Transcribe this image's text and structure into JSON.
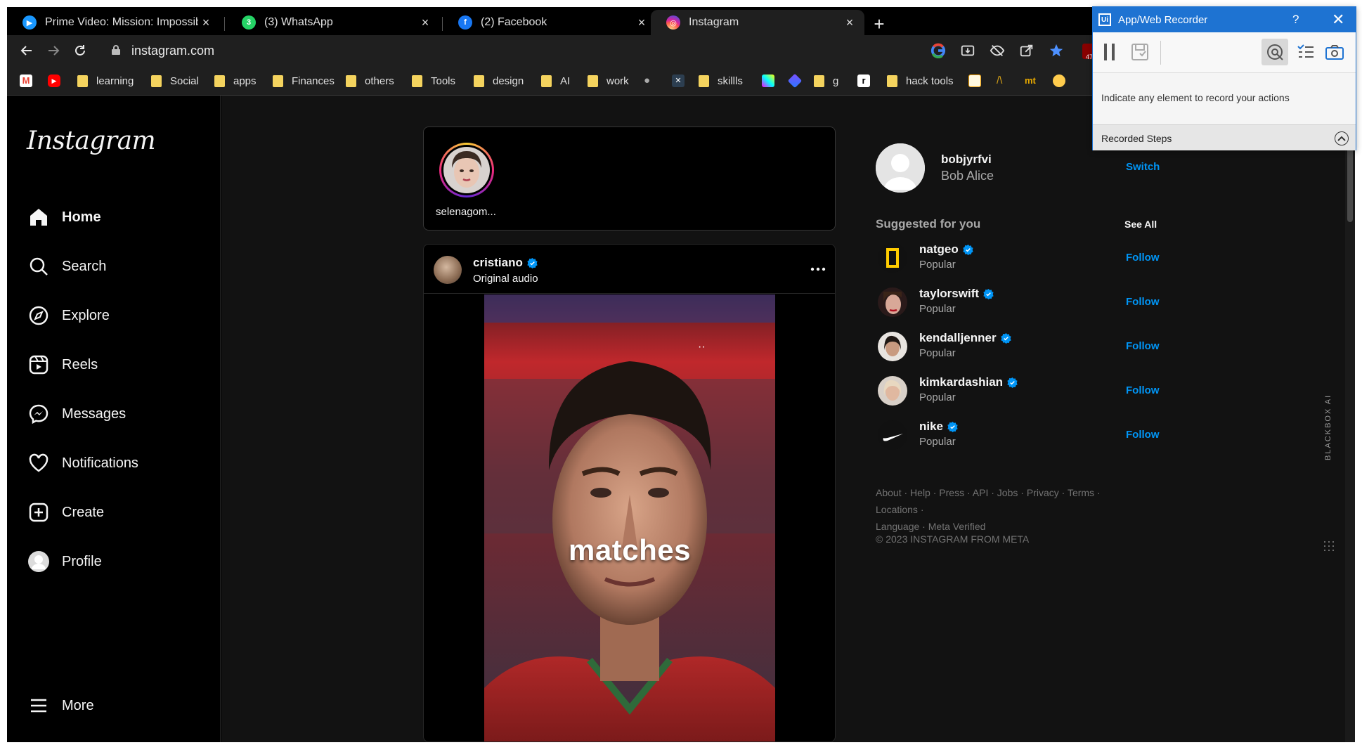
{
  "tabs": [
    {
      "title": "Prime Video: Mission: Impossible",
      "favicon": "prime-video-icon",
      "color": "#1a98ff"
    },
    {
      "title": "(3) WhatsApp",
      "favicon": "whatsapp-icon",
      "color": "#25d366",
      "badge": "3"
    },
    {
      "title": "(2) Facebook",
      "favicon": "facebook-icon",
      "color": "#1877f2"
    },
    {
      "title": "Instagram",
      "favicon": "instagram-icon",
      "color": "#e1306c"
    }
  ],
  "newtab_label": "+",
  "tab_close_glyph": "×",
  "address": {
    "url": "instagram.com"
  },
  "extension_badge": "47",
  "bookmarks": [
    {
      "label": "learning"
    },
    {
      "label": "Social"
    },
    {
      "label": "apps"
    },
    {
      "label": "Finances"
    },
    {
      "label": "others"
    },
    {
      "label": "Tools"
    },
    {
      "label": "design"
    },
    {
      "label": "AI"
    },
    {
      "label": "work"
    },
    {
      "label": "skillls"
    },
    {
      "label": "g"
    },
    {
      "label": "hack tools"
    },
    {
      "label": "mt"
    }
  ],
  "instagram": {
    "logo": "Instagram",
    "nav": [
      {
        "label": "Home",
        "icon": "home-icon"
      },
      {
        "label": "Search",
        "icon": "search-icon"
      },
      {
        "label": "Explore",
        "icon": "compass-icon"
      },
      {
        "label": "Reels",
        "icon": "reels-icon"
      },
      {
        "label": "Messages",
        "icon": "messenger-icon"
      },
      {
        "label": "Notifications",
        "icon": "heart-icon"
      },
      {
        "label": "Create",
        "icon": "plus-square-icon"
      },
      {
        "label": "Profile",
        "icon": "profile-avatar-icon"
      }
    ],
    "more_label": "More",
    "story": {
      "username": "selenagom..."
    },
    "post": {
      "username": "cristiano",
      "subtitle": "Original audio",
      "caption": "matches",
      "more_glyph": "•••",
      "media_indicator": "··"
    },
    "me": {
      "username": "bobjyrfvi",
      "name": "Bob Alice",
      "switch_label": "Switch"
    },
    "suggested_title": "Suggested for you",
    "see_all_label": "See All",
    "suggestions": [
      {
        "username": "natgeo",
        "subtitle": "Popular",
        "action": "Follow"
      },
      {
        "username": "taylorswift",
        "subtitle": "Popular",
        "action": "Follow"
      },
      {
        "username": "kendalljenner",
        "subtitle": "Popular",
        "action": "Follow"
      },
      {
        "username": "kimkardashian",
        "subtitle": "Popular",
        "action": "Follow"
      },
      {
        "username": "nike",
        "subtitle": "Popular",
        "action": "Follow"
      }
    ],
    "footer_links": [
      "About",
      "Help",
      "Press",
      "API",
      "Jobs",
      "Privacy",
      "Terms",
      "Locations",
      "Language",
      "Meta Verified"
    ],
    "copyright": "© 2023 INSTAGRAM FROM META",
    "blackbox_label": "BLACKBOX AI"
  },
  "recorder": {
    "logo": "Ui",
    "title": "App/Web Recorder",
    "help": "?",
    "close": "✕",
    "instruction": "Indicate any element to record your actions",
    "steps_label": "Recorded Steps"
  },
  "colors": {
    "accent": "#0095f6",
    "recorder_blue": "#1e73d2",
    "folder": "#f4d35e"
  }
}
